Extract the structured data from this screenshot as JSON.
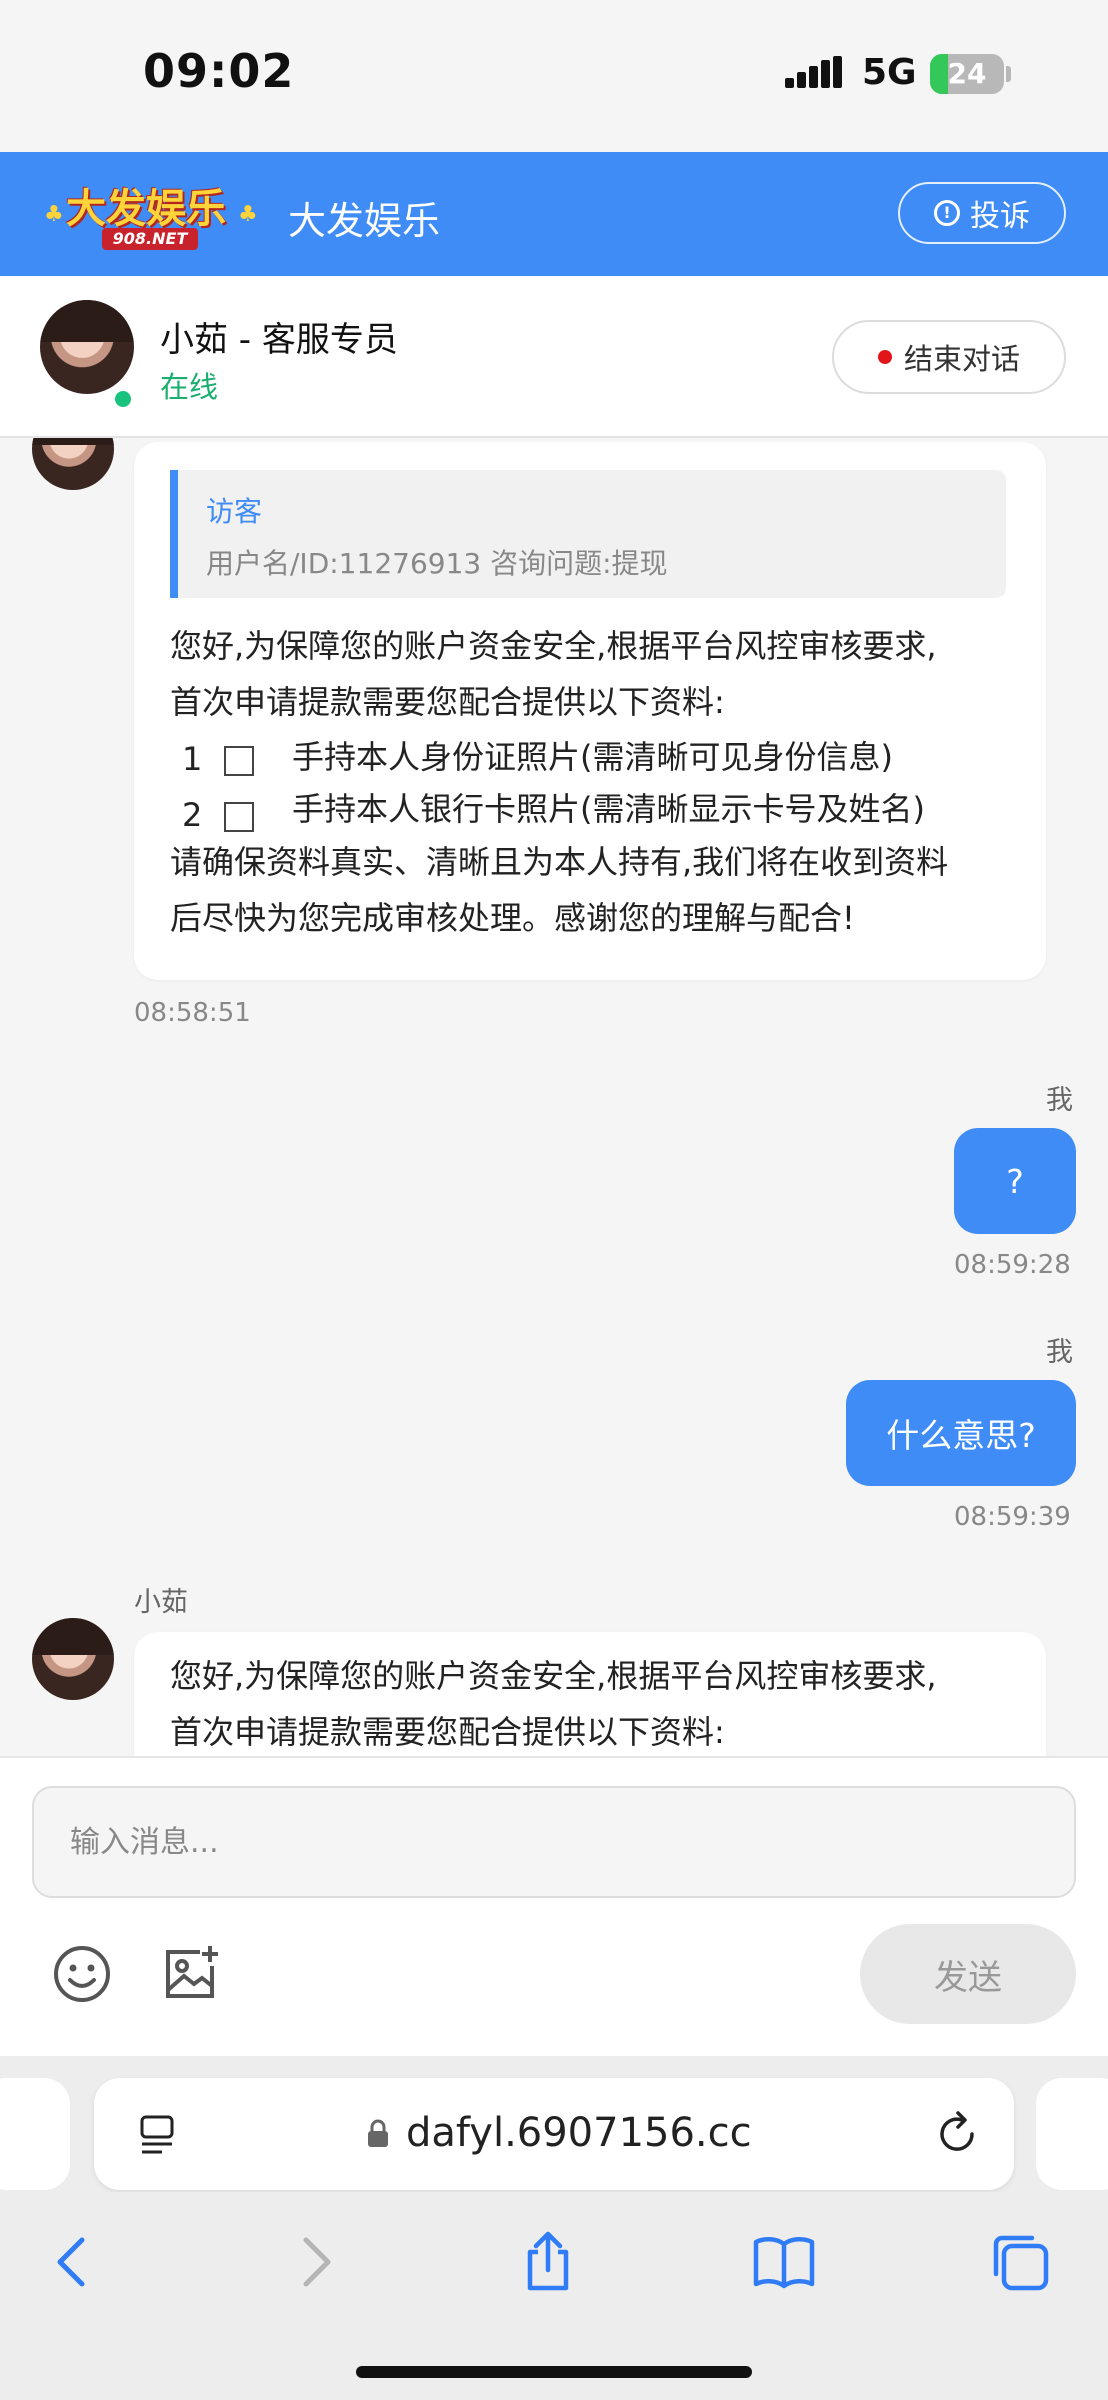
{
  "status_bar": {
    "time": "09:02",
    "network": "5G",
    "battery": "24",
    "battery_level": 0.24
  },
  "header": {
    "logo_text": "大发娱乐",
    "logo_sub": "908.NET",
    "title": "大发娱乐",
    "complain_label": "投诉"
  },
  "agent": {
    "name": "小茹 - 客服专员",
    "status": "在线",
    "end_label": "结束对话"
  },
  "messages": {
    "first": {
      "quote_title": "访客",
      "quote_text": "用户名/ID:11276913 咨询问题:提现",
      "line1": "您好,为保障您的账户资金安全,根据平台风控审核要求,",
      "line2": "首次申请提款需要您配合提供以下资料:",
      "item1_num": "1",
      "item1_text": "手持本人身份证照片(需清晰可见身份信息)",
      "item2_num": "2",
      "item2_text": "手持本人银行卡照片(需清晰显示卡号及姓名)",
      "line3": "请确保资料真实、清晰且为本人持有,我们将在收到资料",
      "line4": "后尽快为您完成审核处理。感谢您的理解与配合!",
      "time": "08:58:51"
    },
    "out1": {
      "sender": "我",
      "text": "?",
      "time": "08:59:28"
    },
    "out2": {
      "sender": "我",
      "text": "什么意思?",
      "time": "08:59:39"
    },
    "second": {
      "sender": "小茹",
      "line1": "您好,为保障您的账户资金安全,根据平台风控审核要求,",
      "line2": "首次申请提款需要您配合提供以下资料:"
    }
  },
  "input": {
    "placeholder": "输入消息...",
    "send_label": "发送"
  },
  "browser": {
    "url": "dafyl.6907156.cc"
  },
  "colors": {
    "accent": "#3f8cf7",
    "online": "#1aae6f",
    "end_dot": "#e2161a",
    "battery": "#34c759"
  }
}
